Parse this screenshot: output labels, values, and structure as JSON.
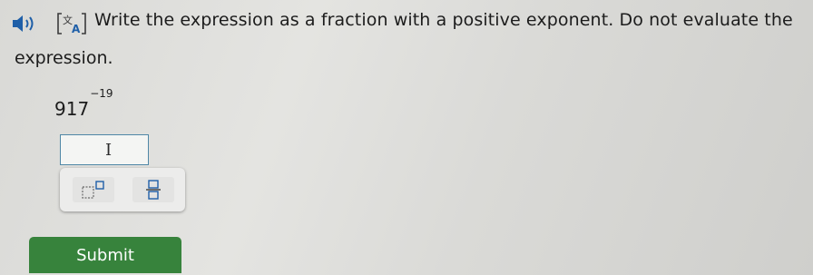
{
  "question": {
    "line1": "Write the expression as a fraction with a positive exponent. Do not evaluate the",
    "line2": "expression."
  },
  "expression": {
    "base": "917",
    "exponent": "−19"
  },
  "answer_input": {
    "value": ""
  },
  "icons": {
    "audio": "speaker-icon",
    "translate": "translate-icon",
    "exponent_tool": "exponent-template-icon",
    "fraction_tool": "fraction-template-icon"
  },
  "submit": {
    "label": "Submit"
  },
  "colors": {
    "submit_bg": "#37833c",
    "input_border": "#4f87a6",
    "icon_blue": "#1f5fa8"
  }
}
